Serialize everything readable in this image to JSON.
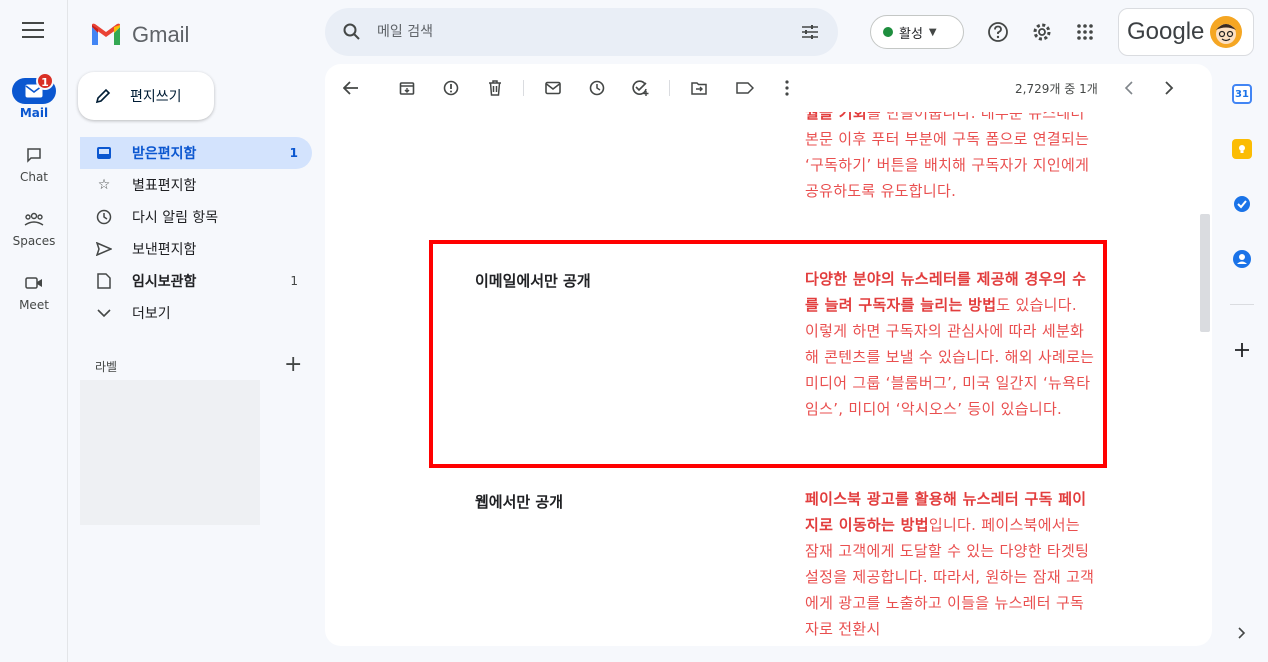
{
  "app": {
    "logo_text": "Gmail"
  },
  "rail": {
    "mail_label": "Mail",
    "mail_badge": "1",
    "chat_label": "Chat",
    "spaces_label": "Spaces",
    "meet_label": "Meet"
  },
  "compose": {
    "label": "편지쓰기"
  },
  "nav": {
    "items": [
      {
        "label": "받은편지함",
        "count": "1",
        "icon": "inbox-icon"
      },
      {
        "label": "별표편지함",
        "count": "",
        "icon": "star-icon"
      },
      {
        "label": "다시 알림 항목",
        "count": "",
        "icon": "clock-icon"
      },
      {
        "label": "보낸편지함",
        "count": "",
        "icon": "send-icon"
      },
      {
        "label": "임시보관함",
        "count": "1",
        "icon": "draft-icon"
      },
      {
        "label": "더보기",
        "count": "",
        "icon": "chevron-down-icon"
      }
    ]
  },
  "labels": {
    "heading": "라벨",
    "add": "+"
  },
  "search": {
    "placeholder": "메일 검색"
  },
  "status": {
    "label": "활성",
    "color": "#1e8e3e"
  },
  "account": {
    "brand": "Google"
  },
  "toolbar": {
    "pager": "2,729개 중 1개"
  },
  "email": {
    "top_partial": "월을 기회를 만들어줍니다. 대부분 뉴스레터 본문 이후 푸터 부분에 구독 폼으로 연결되는 ‘구독하기’ 버튼을 배치해 구독자가 지인에게 공유하도록 유도합니다.",
    "top_partial_bold": "월을 기회",
    "top_partial_rest": "를 만들어줍니다. 대부분 뉴스레터 본문 이후 푸터 부분에 구독 폼으로 연결되는 ‘구독하기’ 버튼을 배치해 구독자가 지인에게 공유하도록 유도합니다.",
    "row1_label": "이메일에서만 공개",
    "row1_bold": "다양한 분야의 뉴스레터를 제공해 경우의 수를 늘려 구독자를 늘리는 방법",
    "row1_rest": "도 있습니다. 이렇게 하면 구독자의 관심사에 따라 세분화해 콘텐츠를 보낼 수 있습니다. 해외 사례로는 미디어 그룹 ‘블룸버그’, 미국 일간지 ‘뉴욕타임스’, 미디어 ‘악시오스’ 등이 있습니다.",
    "row2_label": "웹에서만 공개",
    "row2_bold": "페이스북 광고를 활용해 뉴스레터 구독 페이지로 이동하는 방법",
    "row2_rest": "입니다. 페이스북에서는 잠재 고객에게 도달할 수 있는 다양한 타겟팅 설정을 제공합니다. 따라서, 원하는 잠재 고객에게 광고를 노출하고 이들을 뉴스레터 구독자로 전환시"
  },
  "colors": {
    "accent": "#0b57d0",
    "highlight_border": "#ff0000",
    "body_red": "#e94f4f"
  }
}
